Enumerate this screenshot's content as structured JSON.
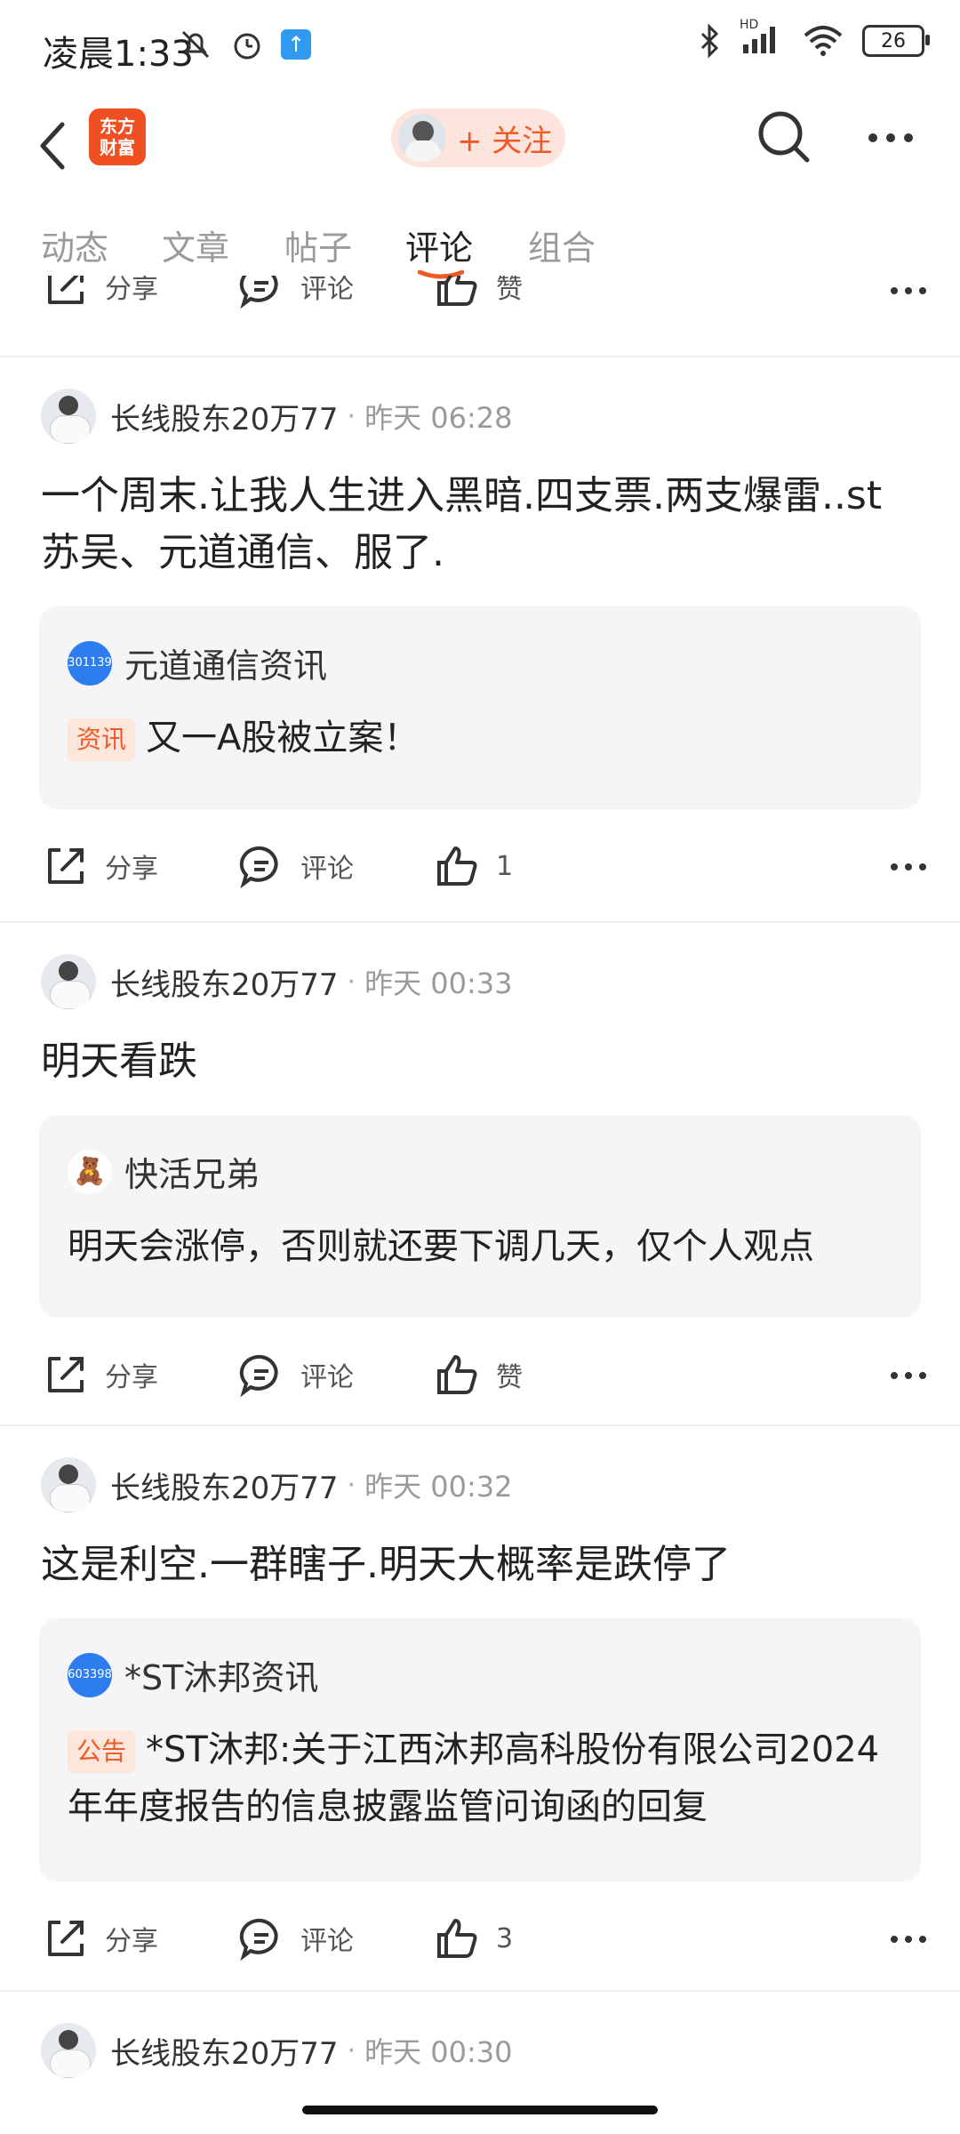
{
  "status": {
    "time": "凌晨1:33",
    "battery": "26",
    "hd_label": "HD"
  },
  "header": {
    "logo_line1": "东方",
    "logo_line2": "财富",
    "follow_label": "+ 关注"
  },
  "tabs": [
    {
      "label": "动态"
    },
    {
      "label": "文章"
    },
    {
      "label": "帖子"
    },
    {
      "label": "评论"
    },
    {
      "label": "组合"
    }
  ],
  "actions": {
    "share": "分享",
    "comment": "评论",
    "like_default": "赞"
  },
  "posts": [
    {
      "author": "长线股东20万77",
      "time": "昨天 06:28",
      "text": "一个周末.让我人生进入黑暗.四支票.两支爆雷..st苏吴、元道通信、服了.",
      "card": {
        "badge": "301139",
        "title": "元道通信资讯",
        "tag": "资讯",
        "body": "又一A股被立案！"
      },
      "likes": "1"
    },
    {
      "author": "长线股东20万77",
      "time": "昨天 00:33",
      "text": "明天看跌",
      "card": {
        "title": "快活兄弟",
        "body": "明天会涨停，否则就还要下调几天，仅个人观点"
      },
      "likes": "赞"
    },
    {
      "author": "长线股东20万77",
      "time": "昨天 00:32",
      "text": "这是利空.一群瞎子.明天大概率是跌停了",
      "card": {
        "badge": "603398",
        "title": "*ST沐邦资讯",
        "tag": "公告",
        "body": "*ST沐邦:关于江西沐邦高科股份有限公司2024年年度报告的信息披露监管问询函的回复"
      },
      "likes": "3"
    },
    {
      "author": "长线股东20万77",
      "time": "昨天 00:30"
    }
  ],
  "colors": {
    "accent": "#f05a28",
    "badge_blue": "#2e7df0",
    "card_bg": "#f5f5f7"
  }
}
